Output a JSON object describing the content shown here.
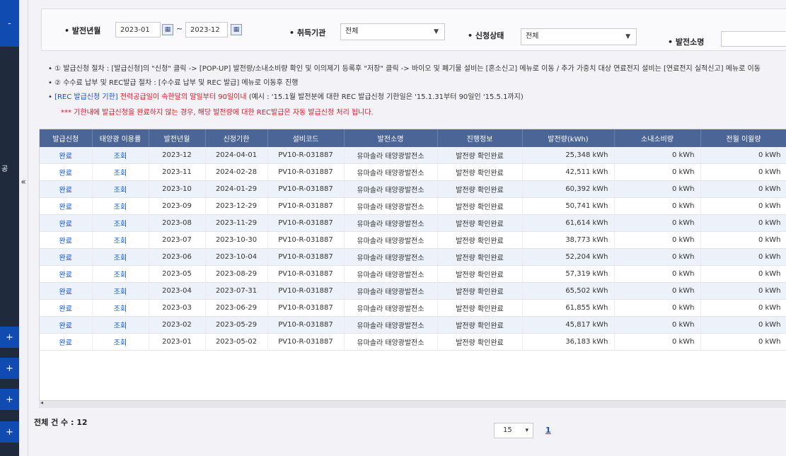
{
  "sidebar": {
    "buttons": [
      "-",
      "+",
      "+",
      "+",
      "+"
    ],
    "cut_label": "공",
    "collapse_icon": "«"
  },
  "filter": {
    "period_label": "발전년월",
    "date_from": "2023-01",
    "date_to": "2023-12",
    "range_sep": "~",
    "agency_label": "취득기관",
    "agency_value": "전체",
    "status_label": "신청상태",
    "status_value": "전체",
    "plant_label": "발전소명",
    "plant_value": ""
  },
  "notes": {
    "n1": "• ① 발급신청 절차 : [발급신청]의 \"신청\" 클릭 -> [POP-UP] 발전량/소내소비량 확인 및 이의제기 등록후 \"저장\" 클릭 -> 바이오 및 폐기물 설비는 [혼소신고] 메뉴로 이동 / 추가 가중치 대상 연료전지 설비는 [연료전지 실적신고] 메뉴로 이동",
    "n2": "• ② 수수료 납부 및 REC발급 절차 : [수수료 납부 및 REC 발급] 메뉴로 이동후 진행",
    "n3_prefix": "• ",
    "n3_blue": "[REC 발급신청 기한]",
    "n3_red": " 전력공급일이 속한달의 말일부터 90일이내",
    "n3_rest": " (예시 : '15.1월 발전분에 대한 REC 발급신청 기한일은 '15.1.31부터 90일인 '15.5.1까지)",
    "n4": "*** 기한내에 발급신청을 완료하지 않는 경우, 해당 발전량에 대한 REC발급은 자동 발급신청 처리 됩니다."
  },
  "table": {
    "headers": [
      "발급신청",
      "태양광 이용률",
      "발전년월",
      "신청기한",
      "설비코드",
      "발전소명",
      "진행정보",
      "발전량(kWh)",
      "소내소비량",
      "전월 이월량"
    ],
    "rows": [
      [
        "완료",
        "조회",
        "2023-12",
        "2024-04-01",
        "PV10-R-031887",
        "유마솔라 태양광발전소",
        "발전량 확인완료",
        "25,348 kWh",
        "0 kWh",
        "0 kWh"
      ],
      [
        "완료",
        "조회",
        "2023-11",
        "2024-02-28",
        "PV10-R-031887",
        "유마솔라 태양광발전소",
        "발전량 확인완료",
        "42,511 kWh",
        "0 kWh",
        "0 kWh"
      ],
      [
        "완료",
        "조회",
        "2023-10",
        "2024-01-29",
        "PV10-R-031887",
        "유마솔라 태양광발전소",
        "발전량 확인완료",
        "60,392 kWh",
        "0 kWh",
        "0 kWh"
      ],
      [
        "완료",
        "조회",
        "2023-09",
        "2023-12-29",
        "PV10-R-031887",
        "유마솔라 태양광발전소",
        "발전량 확인완료",
        "50,741 kWh",
        "0 kWh",
        "0 kWh"
      ],
      [
        "완료",
        "조회",
        "2023-08",
        "2023-11-29",
        "PV10-R-031887",
        "유마솔라 태양광발전소",
        "발전량 확인완료",
        "61,614 kWh",
        "0 kWh",
        "0 kWh"
      ],
      [
        "완료",
        "조회",
        "2023-07",
        "2023-10-30",
        "PV10-R-031887",
        "유마솔라 태양광발전소",
        "발전량 확인완료",
        "38,773 kWh",
        "0 kWh",
        "0 kWh"
      ],
      [
        "완료",
        "조회",
        "2023-06",
        "2023-10-04",
        "PV10-R-031887",
        "유마솔라 태양광발전소",
        "발전량 확인완료",
        "52,204 kWh",
        "0 kWh",
        "0 kWh"
      ],
      [
        "완료",
        "조회",
        "2023-05",
        "2023-08-29",
        "PV10-R-031887",
        "유마솔라 태양광발전소",
        "발전량 확인완료",
        "57,319 kWh",
        "0 kWh",
        "0 kWh"
      ],
      [
        "완료",
        "조회",
        "2023-04",
        "2023-07-31",
        "PV10-R-031887",
        "유마솔라 태양광발전소",
        "발전량 확인완료",
        "65,502 kWh",
        "0 kWh",
        "0 kWh"
      ],
      [
        "완료",
        "조회",
        "2023-03",
        "2023-06-29",
        "PV10-R-031887",
        "유마솔라 태양광발전소",
        "발전량 확인완료",
        "61,855 kWh",
        "0 kWh",
        "0 kWh"
      ],
      [
        "완료",
        "조회",
        "2023-02",
        "2023-05-29",
        "PV10-R-031887",
        "유마솔라 태양광발전소",
        "발전량 확인완료",
        "45,817 kWh",
        "0 kWh",
        "0 kWh"
      ],
      [
        "완료",
        "조회",
        "2023-01",
        "2023-05-02",
        "PV10-R-031887",
        "유마솔라 태양광발전소",
        "발전량 확인완료",
        "36,183 kWh",
        "0 kWh",
        "0 kWh"
      ]
    ]
  },
  "footer": {
    "total": "전체 건 수 : 12",
    "page_size": "15",
    "page": "1"
  }
}
